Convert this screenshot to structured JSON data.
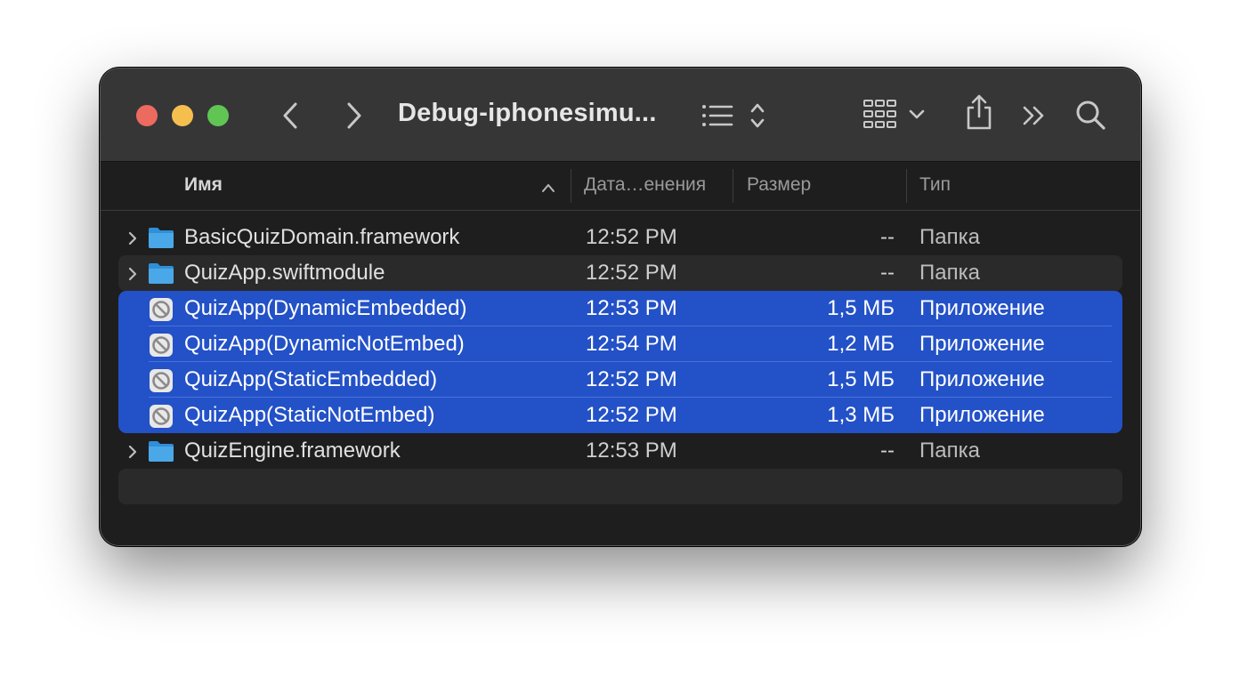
{
  "window": {
    "title": "Debug-iphonesimu..."
  },
  "toolbar": {
    "back_icon": "chevron-left-icon",
    "forward_icon": "chevron-right-icon",
    "view_list_icon": "list-view-icon",
    "view_grid_icon": "grid-view-icon",
    "share_icon": "share-icon",
    "more_icon": "double-chevron-icon",
    "search_icon": "search-icon"
  },
  "columns": {
    "name": "Имя",
    "date": "Дата…енения",
    "size": "Размер",
    "type": "Тип"
  },
  "files": [
    {
      "name": "BasicQuizDomain.framework",
      "date": "12:52 PM",
      "size": "--",
      "type": "Папка",
      "icon": "folder-icon",
      "expandable": true,
      "selected": false
    },
    {
      "name": "QuizApp.swiftmodule",
      "date": "12:52 PM",
      "size": "--",
      "type": "Папка",
      "icon": "folder-icon",
      "expandable": true,
      "selected": false
    },
    {
      "name": "QuizApp(DynamicEmbedded)",
      "date": "12:53 PM",
      "size": "1,5 МБ",
      "type": "Приложение",
      "icon": "prohibited-app-icon",
      "expandable": false,
      "selected": true
    },
    {
      "name": "QuizApp(DynamicNotEmbed)",
      "date": "12:54 PM",
      "size": "1,2 МБ",
      "type": "Приложение",
      "icon": "prohibited-app-icon",
      "expandable": false,
      "selected": true
    },
    {
      "name": "QuizApp(StaticEmbedded)",
      "date": "12:52 PM",
      "size": "1,5 МБ",
      "type": "Приложение",
      "icon": "prohibited-app-icon",
      "expandable": false,
      "selected": true
    },
    {
      "name": "QuizApp(StaticNotEmbed)",
      "date": "12:52 PM",
      "size": "1,3 МБ",
      "type": "Приложение",
      "icon": "prohibited-app-icon",
      "expandable": false,
      "selected": true
    },
    {
      "name": "QuizEngine.framework",
      "date": "12:53 PM",
      "size": "--",
      "type": "Папка",
      "icon": "folder-icon",
      "expandable": true,
      "selected": false
    }
  ],
  "colors": {
    "selection": "#2351c7",
    "folder": "#4aa8e8",
    "close": "#ed6a5e",
    "minimize": "#f5bf4f",
    "zoom": "#61c554"
  }
}
